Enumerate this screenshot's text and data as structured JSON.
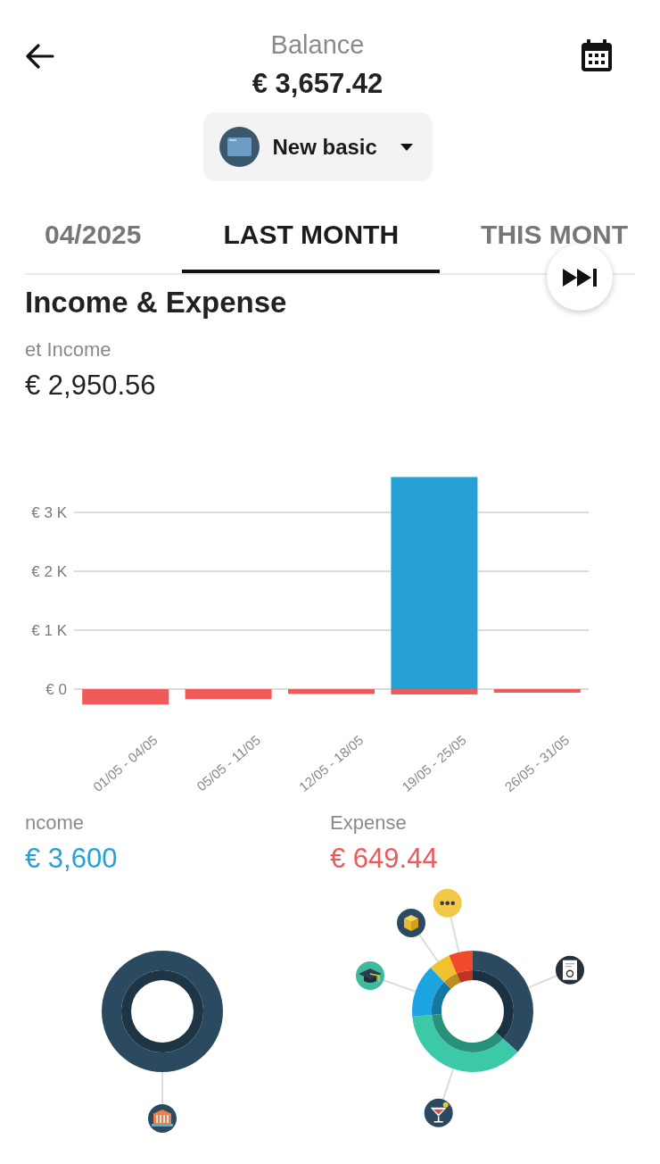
{
  "header": {
    "title": "Balance",
    "amount": "€ 3,657.42"
  },
  "account_selector": {
    "label": "New basic"
  },
  "tabs": [
    {
      "label": "04/2025",
      "selected": false
    },
    {
      "label": "LAST MONTH",
      "selected": true
    },
    {
      "label": "THIS MONT",
      "selected": false
    }
  ],
  "summary": {
    "title": "Income & Expense",
    "net_label": "et Income",
    "net_amount": "€ 2,950.56",
    "chart_data": {
      "type": "bar",
      "categories": [
        "01/05 - 04/05",
        "05/05 - 11/05",
        "12/05 - 18/05",
        "19/05 - 25/05",
        "26/05 - 31/05"
      ],
      "series": [
        {
          "color": "#25a1d5",
          "values": [
            null,
            null,
            null,
            3600,
            null
          ]
        },
        {
          "color": "#f05a5a",
          "values": [
            -260,
            -170,
            -80,
            -90,
            -60
          ]
        }
      ],
      "stacked": true,
      "grid": true,
      "ylim": [
        -260,
        3600
      ],
      "yticks": [
        {
          "value": 0,
          "label": "€ 0"
        },
        {
          "value": 1000,
          "label": "€ 1 K"
        },
        {
          "value": 2000,
          "label": "€ 2 K"
        },
        {
          "value": 3000,
          "label": "€ 3 K"
        }
      ]
    }
  },
  "totals": [
    {
      "label": "ncome",
      "amount": "€ 3,600",
      "color": "#25a1d5"
    },
    {
      "label": "Expense",
      "amount": "€ 649.44",
      "color": "#ec5a5a"
    }
  ]
}
